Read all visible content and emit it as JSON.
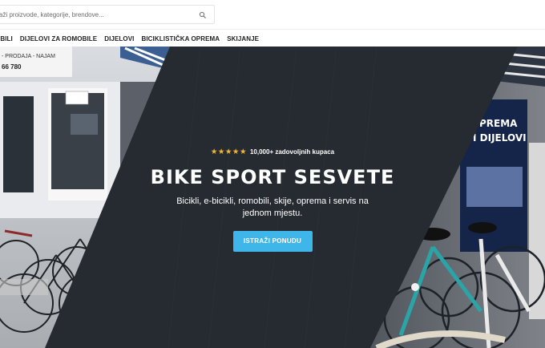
{
  "header": {
    "search": {
      "placeholder": "aži proizvode, kategorije, brendove..."
    }
  },
  "nav": {
    "items": [
      {
        "label": "OBILI"
      },
      {
        "label": "DIJELOVI ZA ROMOBILE"
      },
      {
        "label": "DIJELOVI"
      },
      {
        "label": "BICIKLISTIČKA OPREMA"
      },
      {
        "label": "SKIJANJE"
      }
    ]
  },
  "hero": {
    "rating": {
      "stars": "★★★★★",
      "text": "10,000+ zadovoljnih kupaca"
    },
    "title": "BIKE SPORT SESVETE",
    "subtitle": "Bicikli, e-bicikli, romobili, skije, oprema i servis na jednom mjestu.",
    "cta_label": "ISTRAŽI PONUDU",
    "photo_signs": {
      "left_sign_line1": "- PRODAJA - NAJAM",
      "left_sign_line2": "66 780",
      "right_sign_line1": "PREMA",
      "right_sign_line2": "I DIJELOVI"
    }
  },
  "colors": {
    "accent": "#3fb6ea",
    "star": "#f5b731",
    "hero_panel": "#262b31",
    "nav_text": "#222222"
  },
  "icons": {
    "search": "search-icon",
    "star": "star-icon"
  }
}
